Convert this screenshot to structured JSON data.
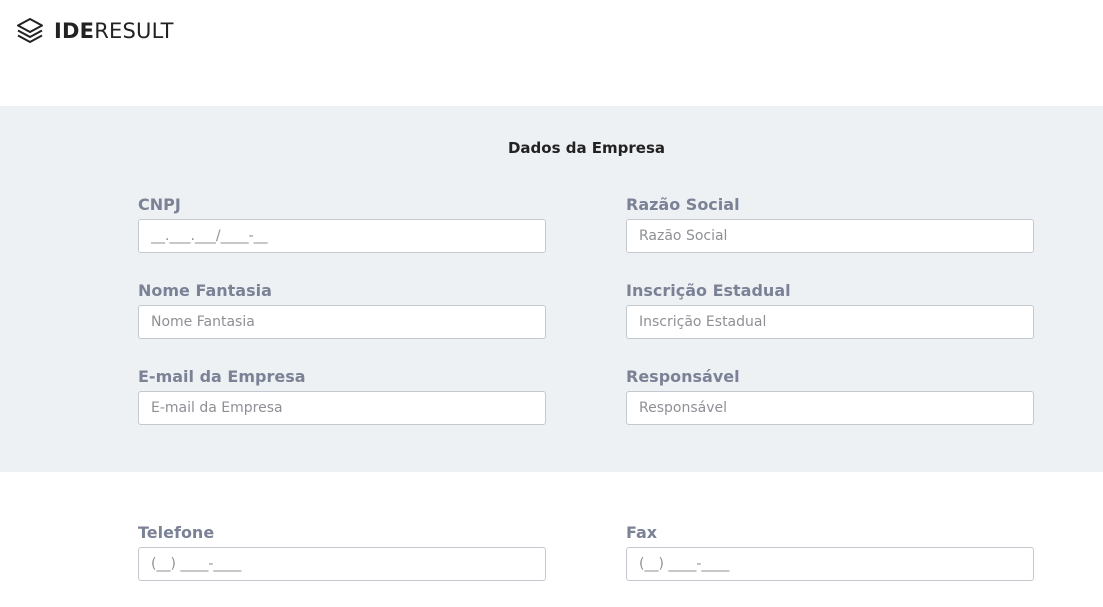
{
  "brand": {
    "name_bold": "IDE",
    "name_light": "RESULT",
    "icon": "layers-icon"
  },
  "company_section": {
    "title": "Dados da Empresa",
    "fields": {
      "cnpj": {
        "label": "CNPJ",
        "value": "__.___.___/____-__",
        "placeholder": ""
      },
      "razao_social": {
        "label": "Razão Social",
        "value": "",
        "placeholder": "Razão Social"
      },
      "nome_fantasia": {
        "label": "Nome Fantasia",
        "value": "",
        "placeholder": "Nome Fantasia"
      },
      "inscricao_estadual": {
        "label": "Inscrição Estadual",
        "value": "",
        "placeholder": "Inscrição Estadual"
      },
      "email_empresa": {
        "label": "E-mail da Empresa",
        "value": "",
        "placeholder": "E-mail da Empresa"
      },
      "responsavel": {
        "label": "Responsável",
        "value": "",
        "placeholder": "Responsável"
      }
    }
  },
  "contact_section": {
    "fields": {
      "telefone": {
        "label": "Telefone",
        "value": "(__) ____-____",
        "placeholder": ""
      },
      "fax": {
        "label": "Fax",
        "value": "(__) ____-____",
        "placeholder": ""
      }
    }
  },
  "colors": {
    "section_background": "#eef1f4",
    "label": "#7b8296",
    "input_border": "#c4c8cf"
  }
}
